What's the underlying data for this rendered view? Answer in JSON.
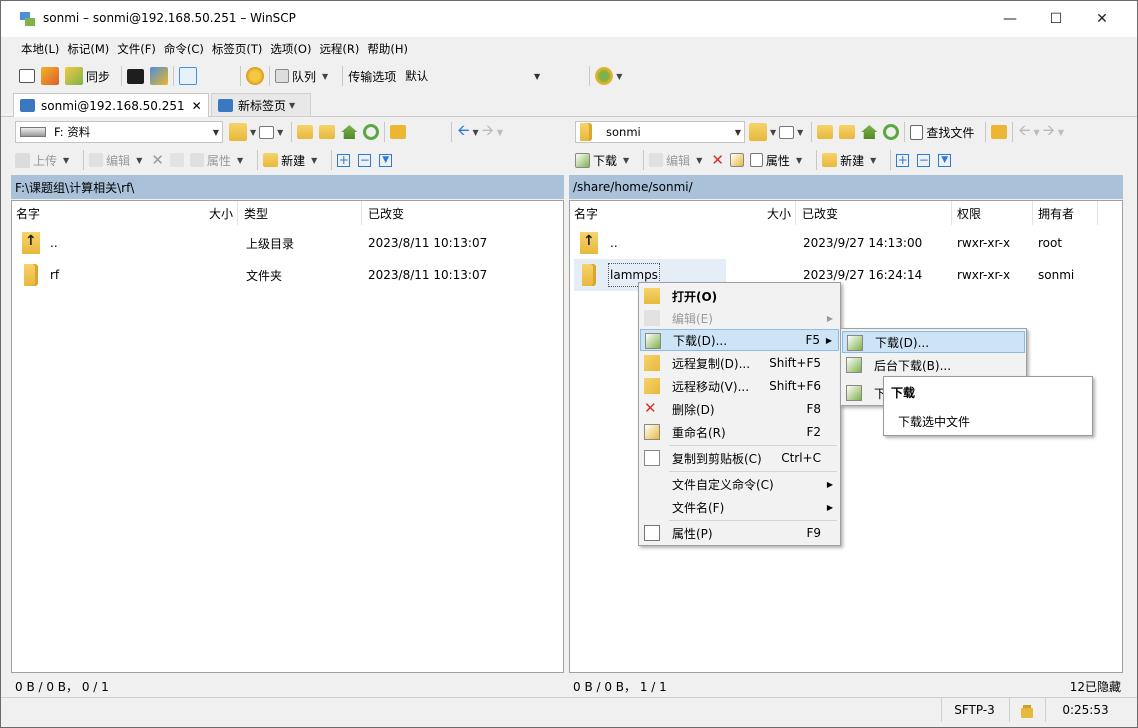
{
  "window": {
    "title": "sonmi – sonmi@192.168.50.251 – WinSCP"
  },
  "menubar": [
    "本地(L)",
    "标记(M)",
    "文件(F)",
    "命令(C)",
    "标签页(T)",
    "选项(O)",
    "远程(R)",
    "帮助(H)"
  ],
  "toolbar": {
    "sync_label": "同步",
    "queue_label": "队列",
    "transfer_label": "传输选项",
    "transfer_value": "默认"
  },
  "tabs": [
    {
      "label": "sonmi@192.168.50.251"
    },
    {
      "label": "新标签页"
    }
  ],
  "left": {
    "drive": "F: 资料",
    "upload_label": "上传",
    "edit_label": "编辑",
    "props_label": "属性",
    "new_label": "新建",
    "path": "F:\\课题组\\计算相关\\rf\\",
    "columns": [
      "名字",
      "大小",
      "类型",
      "已改变"
    ],
    "rows": [
      {
        "name": "..",
        "size": "",
        "type": "上级目录",
        "changed": "2023/8/11 10:13:07"
      },
      {
        "name": "rf",
        "size": "",
        "type": "文件夹",
        "changed": "2023/8/11 10:13:07"
      }
    ],
    "status": "0 B / 0 B，  0 / 1"
  },
  "right": {
    "folder": "sonmi",
    "find_label": "查找文件",
    "download_label": "下载",
    "edit_label": "编辑",
    "props_label": "属性",
    "new_label": "新建",
    "path": "/share/home/sonmi/",
    "columns": [
      "名字",
      "大小",
      "已改变",
      "权限",
      "拥有者"
    ],
    "rows": [
      {
        "name": "..",
        "size": "",
        "changed": "2023/9/27 14:13:00",
        "perm": "rwxr-xr-x",
        "owner": "root"
      },
      {
        "name": "lammps",
        "size": "",
        "changed": "2023/9/27 16:24:14",
        "perm": "rwxr-xr-x",
        "owner": "sonmi"
      }
    ],
    "status": "0 B / 0 B，  1 / 1",
    "hidden": "12已隐藏"
  },
  "context_menu": {
    "items": [
      {
        "label": "打开(O)",
        "shortcut": ""
      },
      {
        "label": "编辑(E)",
        "shortcut": ""
      },
      {
        "label": "下载(D)...",
        "shortcut": "F5"
      },
      {
        "label": "远程复制(D)...",
        "shortcut": "Shift+F5"
      },
      {
        "label": "远程移动(V)...",
        "shortcut": "Shift+F6"
      },
      {
        "label": "删除(D)",
        "shortcut": "F8"
      },
      {
        "label": "重命名(R)",
        "shortcut": "F2"
      },
      {
        "label": "复制到剪贴板(C)",
        "shortcut": "Ctrl+C"
      },
      {
        "label": "文件自定义命令(C)",
        "shortcut": ""
      },
      {
        "label": "文件名(F)",
        "shortcut": ""
      },
      {
        "label": "属性(P)",
        "shortcut": "F9"
      }
    ]
  },
  "submenu": {
    "items": [
      "下载(D)...",
      "后台下载(B)...",
      "下"
    ]
  },
  "tooltip": {
    "title": "下载",
    "text": "下载选中文件"
  },
  "statusbar": {
    "protocol": "SFTP-3",
    "time": "0:25:53"
  },
  "colors": {
    "path_bg": "#a9c2d9",
    "selection": "#cde4f7",
    "highlight_border": "#8cbbe6",
    "delete_red": "#d9302c"
  }
}
